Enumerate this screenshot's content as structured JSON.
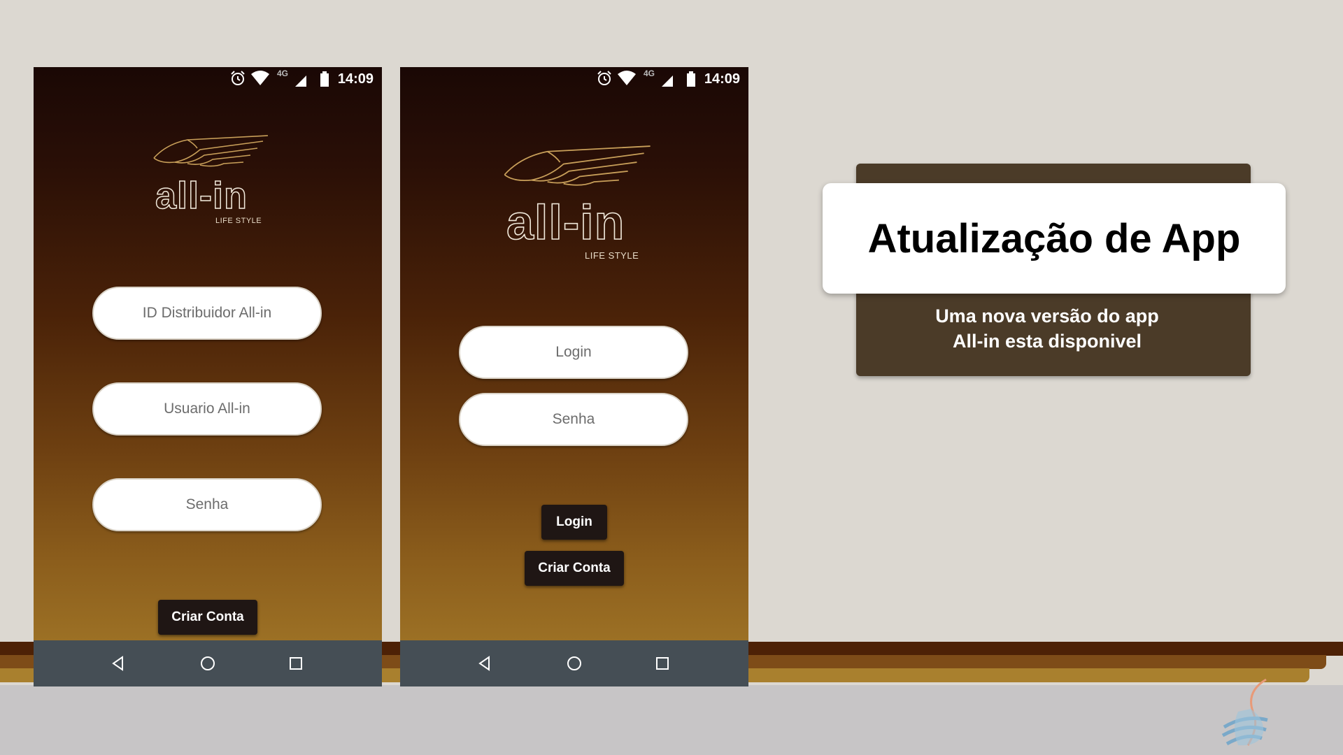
{
  "phone_left": {
    "status_bar": {
      "time": "14:09",
      "network": "4G"
    },
    "logo": {
      "wordmark": "all-in",
      "tagline": "LIFE STYLE"
    },
    "fields": [
      {
        "placeholder": "ID Distribuidor All-in"
      },
      {
        "placeholder": "Usuario All-in"
      },
      {
        "placeholder": "Senha"
      }
    ],
    "create_account_label": "Criar Conta"
  },
  "phone_right": {
    "status_bar": {
      "time": "14:09",
      "network": "4G"
    },
    "logo": {
      "wordmark": "all-in",
      "tagline": "LIFE STYLE"
    },
    "fields": [
      {
        "placeholder": "Login"
      },
      {
        "placeholder": "Senha"
      }
    ],
    "login_label": "Login",
    "create_account_label": "Criar Conta"
  },
  "update_card": {
    "title": "Atualização de App",
    "subtitle_line1": "Uma nova versão do app",
    "subtitle_line2": "All-in esta disponivel"
  },
  "colors": {
    "card_dark": "#4b3b28",
    "button_dark": "#1f1614",
    "navbar": "#454e55",
    "stripe_dark": "#4d2106",
    "stripe_mid": "#7e4c18",
    "stripe_light": "#a9802e"
  },
  "icons": [
    "alarm-icon",
    "wifi-icon",
    "signal-icon",
    "battery-icon",
    "back-icon",
    "home-icon",
    "recents-icon",
    "wing-logo-icon"
  ]
}
